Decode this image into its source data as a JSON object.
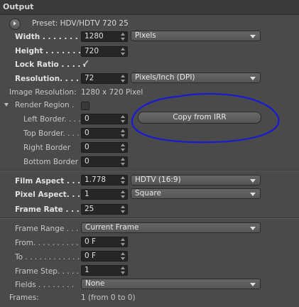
{
  "panel": {
    "title": "Output"
  },
  "preset": {
    "label": "Preset: HDV/HDTV 720 25"
  },
  "width": {
    "label": "Width . . . . . . . .",
    "value": "1280",
    "unit": "Pixels"
  },
  "height": {
    "label": "Height . . . . . . . .",
    "value": "720"
  },
  "lock_ratio": {
    "label": "Lock Ratio . . . . .",
    "check": "✓"
  },
  "resolution": {
    "label": "Resolution. . . . .",
    "value": "72",
    "unit": "Pixels/Inch (DPI)"
  },
  "image_resolution": {
    "label": "Image Resolution:",
    "value": "1280 x 720 Pixel"
  },
  "render_region": {
    "label": "Render Region .",
    "left_border": {
      "label": "Left Border. . . .",
      "value": "0"
    },
    "top_border": {
      "label": "Top Border. . . .",
      "value": "0"
    },
    "right_border": {
      "label": "Right Border",
      "value": "0"
    },
    "bottom_border": {
      "label": "Bottom Border",
      "value": "0"
    },
    "copy_button": "Copy from IRR"
  },
  "film_aspect": {
    "label": "Film Aspect . . . .",
    "value": "1.778",
    "preset": "HDTV (16:9)"
  },
  "pixel_aspect": {
    "label": "Pixel Aspect. . . .",
    "value": "1",
    "preset": "Square"
  },
  "frame_rate": {
    "label": "Frame Rate . . . .",
    "value": "25"
  },
  "frame_range": {
    "label": "Frame Range . . .",
    "value": "Current Frame"
  },
  "from": {
    "label": "From. . . . . . . . . .",
    "value": "0 F"
  },
  "to": {
    "label": "To . . . . . . . . . . . .",
    "value": "0 F"
  },
  "frame_step": {
    "label": "Frame Step. . . . .",
    "value": "1"
  },
  "fields": {
    "label": "Fields . . . . . . . .",
    "value": "None"
  },
  "frames": {
    "label": "Frames:",
    "value": "1 (from 0 to 0)"
  },
  "colors": {
    "annotation": "#1a1ad0"
  }
}
